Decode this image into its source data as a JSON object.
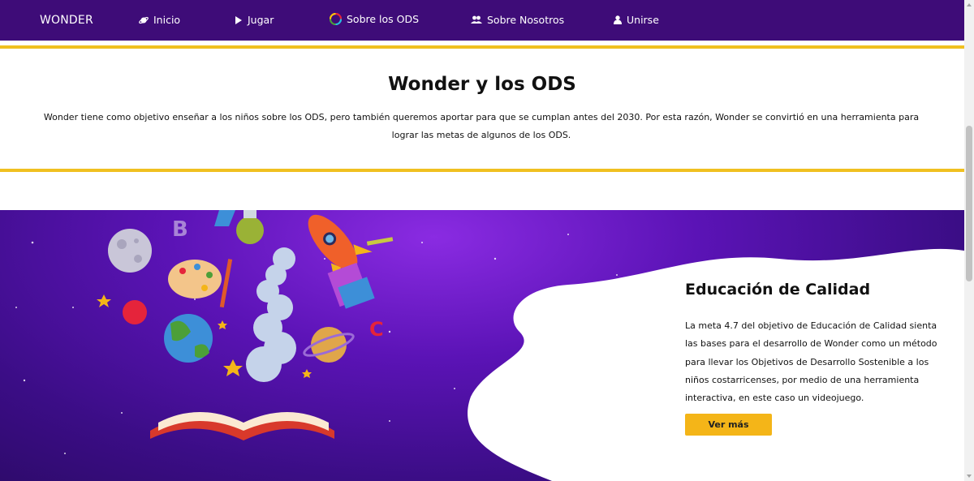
{
  "nav": {
    "brand": "WONDER",
    "items": [
      {
        "label": "Inicio",
        "icon": "planet-icon"
      },
      {
        "label": "Jugar",
        "icon": "play-icon"
      },
      {
        "label": "Sobre los ODS",
        "icon": "sdg-wheel-icon"
      },
      {
        "label": "Sobre Nosotros",
        "icon": "group-icon"
      },
      {
        "label": "Unirse",
        "icon": "user-icon"
      }
    ]
  },
  "intro": {
    "title": "Wonder y los ODS",
    "text": "Wonder tiene como objetivo enseñar a los niños sobre los ODS, pero también queremos aportar para que se cumplan antes del 2030. Por esta razón, Wonder se convirtió en una herramienta para lograr las metas de algunos de los ODS."
  },
  "feature": {
    "title": "Educación de Calidad",
    "text": "La meta 4.7 del objetivo de Educación de Calidad sienta las bases para el desarrollo de Wonder como un método para llevar los Objetivos de Desarrollo Sostenible a los niños costarricenses, por medio de una herramienta interactiva, en este caso un videojuego.",
    "button": "Ver más"
  },
  "colors": {
    "nav_bg": "#3e0c78",
    "accent_yellow": "#f0c020",
    "button_yellow": "#f4b518",
    "hero_purple": "#5b13b6"
  }
}
